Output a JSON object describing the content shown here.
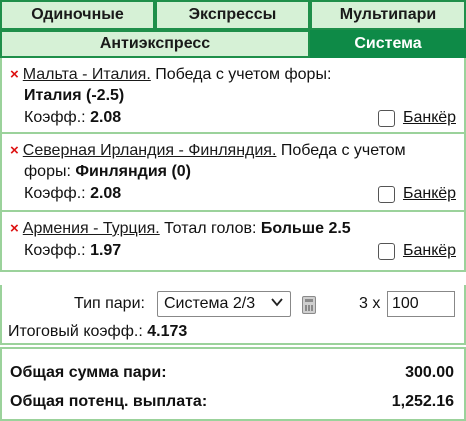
{
  "tabs": {
    "row1": [
      {
        "label": "Одиночные"
      },
      {
        "label": "Экспрессы"
      },
      {
        "label": "Мультипари"
      }
    ],
    "row2": [
      {
        "label": "Антиэкспресс"
      },
      {
        "label": "Система"
      }
    ],
    "active": "Система"
  },
  "bets": [
    {
      "match": "Мальта - Италия.",
      "market": " Победа с учетом форы:",
      "pick": "Италия (-2.5)",
      "coef_label": "Коэфф.:",
      "coef": "2.08",
      "banker": "Банкёр"
    },
    {
      "match": "Северная Ирландия - Финляндия.",
      "market": " Победа с учетом",
      "market_cont": "форы:",
      "pick": "Финляндия (0)",
      "coef_label": "Коэфф.:",
      "coef": "2.08",
      "banker": "Банкёр"
    },
    {
      "match": "Армения - Турция.",
      "market": " Тотал голов:",
      "pick": "Больше 2.5",
      "coef_label": "Коэфф.:",
      "coef": "1.97",
      "banker": "Банкёр"
    }
  ],
  "remove_icon": "×",
  "system": {
    "type_label": "Тип пари:",
    "type_value": "Система 2/3",
    "multiplier": "3 x",
    "stake": "100",
    "total_coef_label": "Итоговый коэфф.:",
    "total_coef": "4.173"
  },
  "summary": {
    "total_stake_label": "Общая сумма пари:",
    "total_stake": "300.00",
    "potential_label": "Общая потенц. выплата:",
    "potential": "1,252.16"
  },
  "colors": {
    "active_tab": "#0e8a47",
    "inactive_tab": "#d6f1d6",
    "border": "#9bd29b",
    "remove": "#dd1111"
  }
}
